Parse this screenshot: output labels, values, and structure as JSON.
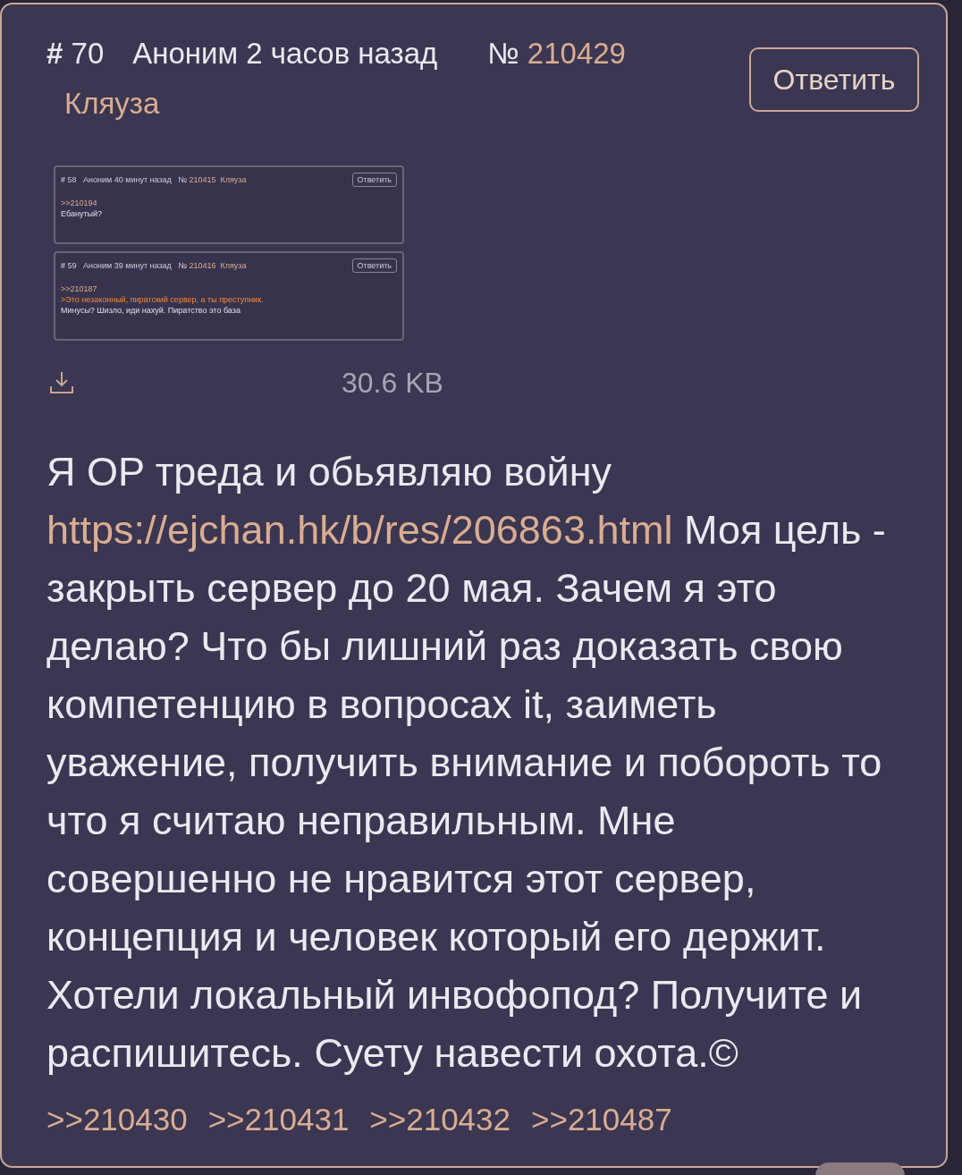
{
  "post": {
    "number_mark": "#",
    "number": "70",
    "author": "Аноним",
    "time": "2 часов назад",
    "id_mark": "№",
    "id": "210429",
    "board": "Кляуза",
    "reply_button": "Ответить",
    "attachment": {
      "size": "30.6 KB",
      "posts": [
        {
          "number_mark": "#",
          "number": "58",
          "author": "Аноним",
          "time": "40 минут назад",
          "id_mark": "№",
          "id": "210415",
          "board": "Кляуза",
          "reply_button": "Ответить",
          "lines": [
            {
              "kind": "link",
              "text": ">>210194"
            },
            {
              "kind": "plain",
              "text": "Ебанутый?"
            }
          ]
        },
        {
          "number_mark": "#",
          "number": "59",
          "author": "Аноним",
          "time": "39 минут назад",
          "id_mark": "№",
          "id": "210416",
          "board": "Кляуза",
          "reply_button": "Ответить",
          "lines": [
            {
              "kind": "link",
              "text": ">>210187"
            },
            {
              "kind": "quote",
              "text": ">Это незаконный, пиратский сервер, а ты преступник."
            },
            {
              "kind": "plain",
              "text": "Минусы? Шизло, иди нахуй. Пиратство это база"
            }
          ]
        }
      ]
    },
    "body_before": "Я OP треда и обьявляю войну",
    "body_link": "https://ejchan.hk/b/res/206863.html",
    "body_after": "Моя цель - закрыть сервер до 20 мая. Зачем я это делаю? Что бы лишний раз доказать свою компетенцию в вопросах it, заиметь уважение, получить внимание и побороть то что я считаю неправильным. Мне совершенно не нравится этот сервер, концепция и человек который его держит. Хотели локальный инвофопод? Получите и распишитесь. Суету навести охота.©",
    "replies": [
      ">>210430",
      ">>210431",
      ">>210432",
      ">>210487"
    ]
  }
}
